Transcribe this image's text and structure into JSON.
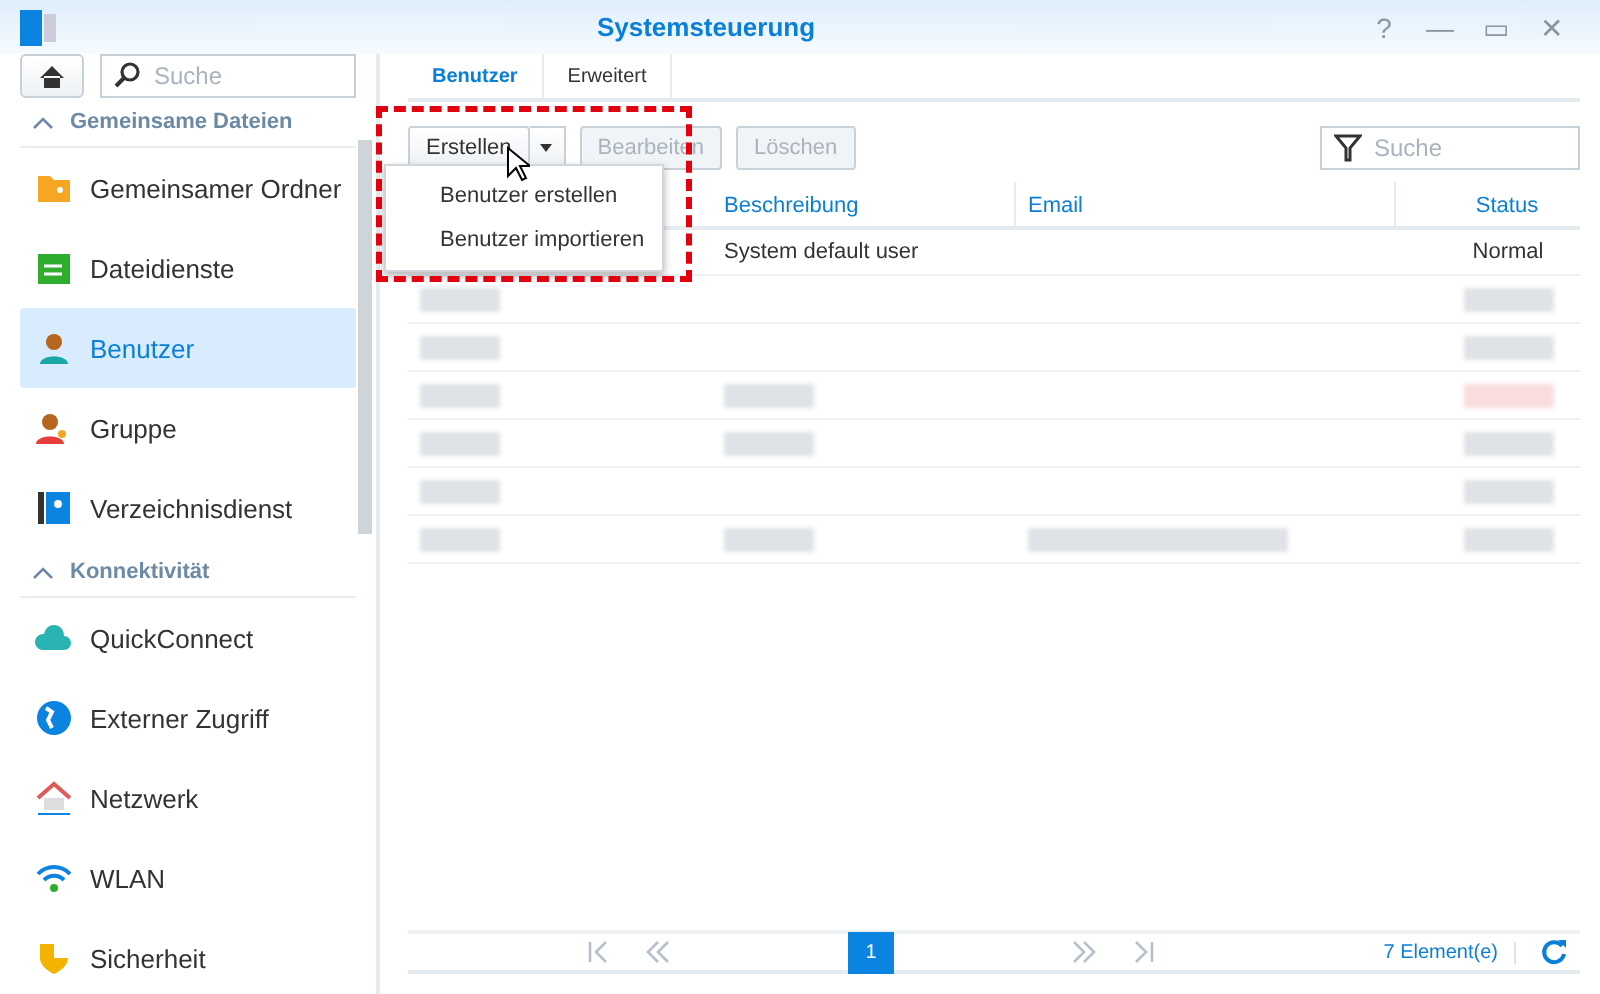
{
  "window": {
    "title": "Systemsteuerung",
    "controls": [
      "?",
      "—",
      "▭",
      "✕"
    ]
  },
  "sidebar": {
    "search": {
      "placeholder": "Suche"
    },
    "sections": [
      {
        "title": "Gemeinsame Dateien",
        "expanded": true,
        "items": [
          {
            "label": "Gemeinsamer Ordner",
            "selected": false
          },
          {
            "label": "Dateidienste",
            "selected": false
          },
          {
            "label": "Benutzer",
            "selected": true
          },
          {
            "label": "Gruppe",
            "selected": false
          },
          {
            "label": "Verzeichnisdienst",
            "selected": false
          }
        ]
      },
      {
        "title": "Konnektivität",
        "expanded": true,
        "items": [
          {
            "label": "QuickConnect",
            "selected": false
          },
          {
            "label": "Externer Zugriff",
            "selected": false
          },
          {
            "label": "Netzwerk",
            "selected": false
          },
          {
            "label": "WLAN",
            "selected": false
          },
          {
            "label": "Sicherheit",
            "selected": false
          }
        ]
      }
    ]
  },
  "tabs": [
    {
      "label": "Benutzer",
      "selected": true
    },
    {
      "label": "Erweitert",
      "selected": false
    }
  ],
  "toolbar": {
    "buttons": [
      {
        "label": "Erstellen",
        "disabled": false,
        "dropdown": true
      },
      {
        "label": "Bearbeiten",
        "disabled": true,
        "dropdown": false
      },
      {
        "label": "Löschen",
        "disabled": true,
        "dropdown": false
      }
    ],
    "filter": {
      "placeholder": "Suche"
    }
  },
  "dropdown_menu": {
    "items": [
      "Benutzer erstellen",
      "Benutzer importieren"
    ]
  },
  "table": {
    "columns": [
      "Beschreibung",
      "Email",
      "Status"
    ],
    "rows": [
      {
        "kind": "text",
        "description": "System default user",
        "status": "Normal"
      },
      {
        "kind": "blurred",
        "name_blurred": true,
        "description_blurred": false,
        "email_blurred": false,
        "status_blurred": true,
        "alert": false
      },
      {
        "kind": "blurred",
        "name_blurred": true,
        "description_blurred": false,
        "email_blurred": false,
        "status_blurred": true,
        "alert": false
      },
      {
        "kind": "blurred",
        "name_blurred": true,
        "description_blurred": true,
        "email_blurred": false,
        "status_blurred": true,
        "alert": true
      },
      {
        "kind": "blurred",
        "name_blurred": true,
        "description_blurred": true,
        "email_blurred": false,
        "status_blurred": true,
        "alert": false
      },
      {
        "kind": "blurred",
        "name_blurred": true,
        "description_blurred": false,
        "email_blurred": false,
        "status_blurred": true,
        "alert": false
      },
      {
        "kind": "blurred",
        "name_blurred": true,
        "description_blurred": true,
        "email_blurred": true,
        "status_blurred": true,
        "alert": false
      }
    ]
  },
  "pager": {
    "current_page": "1",
    "count": "7 Element(e)"
  }
}
